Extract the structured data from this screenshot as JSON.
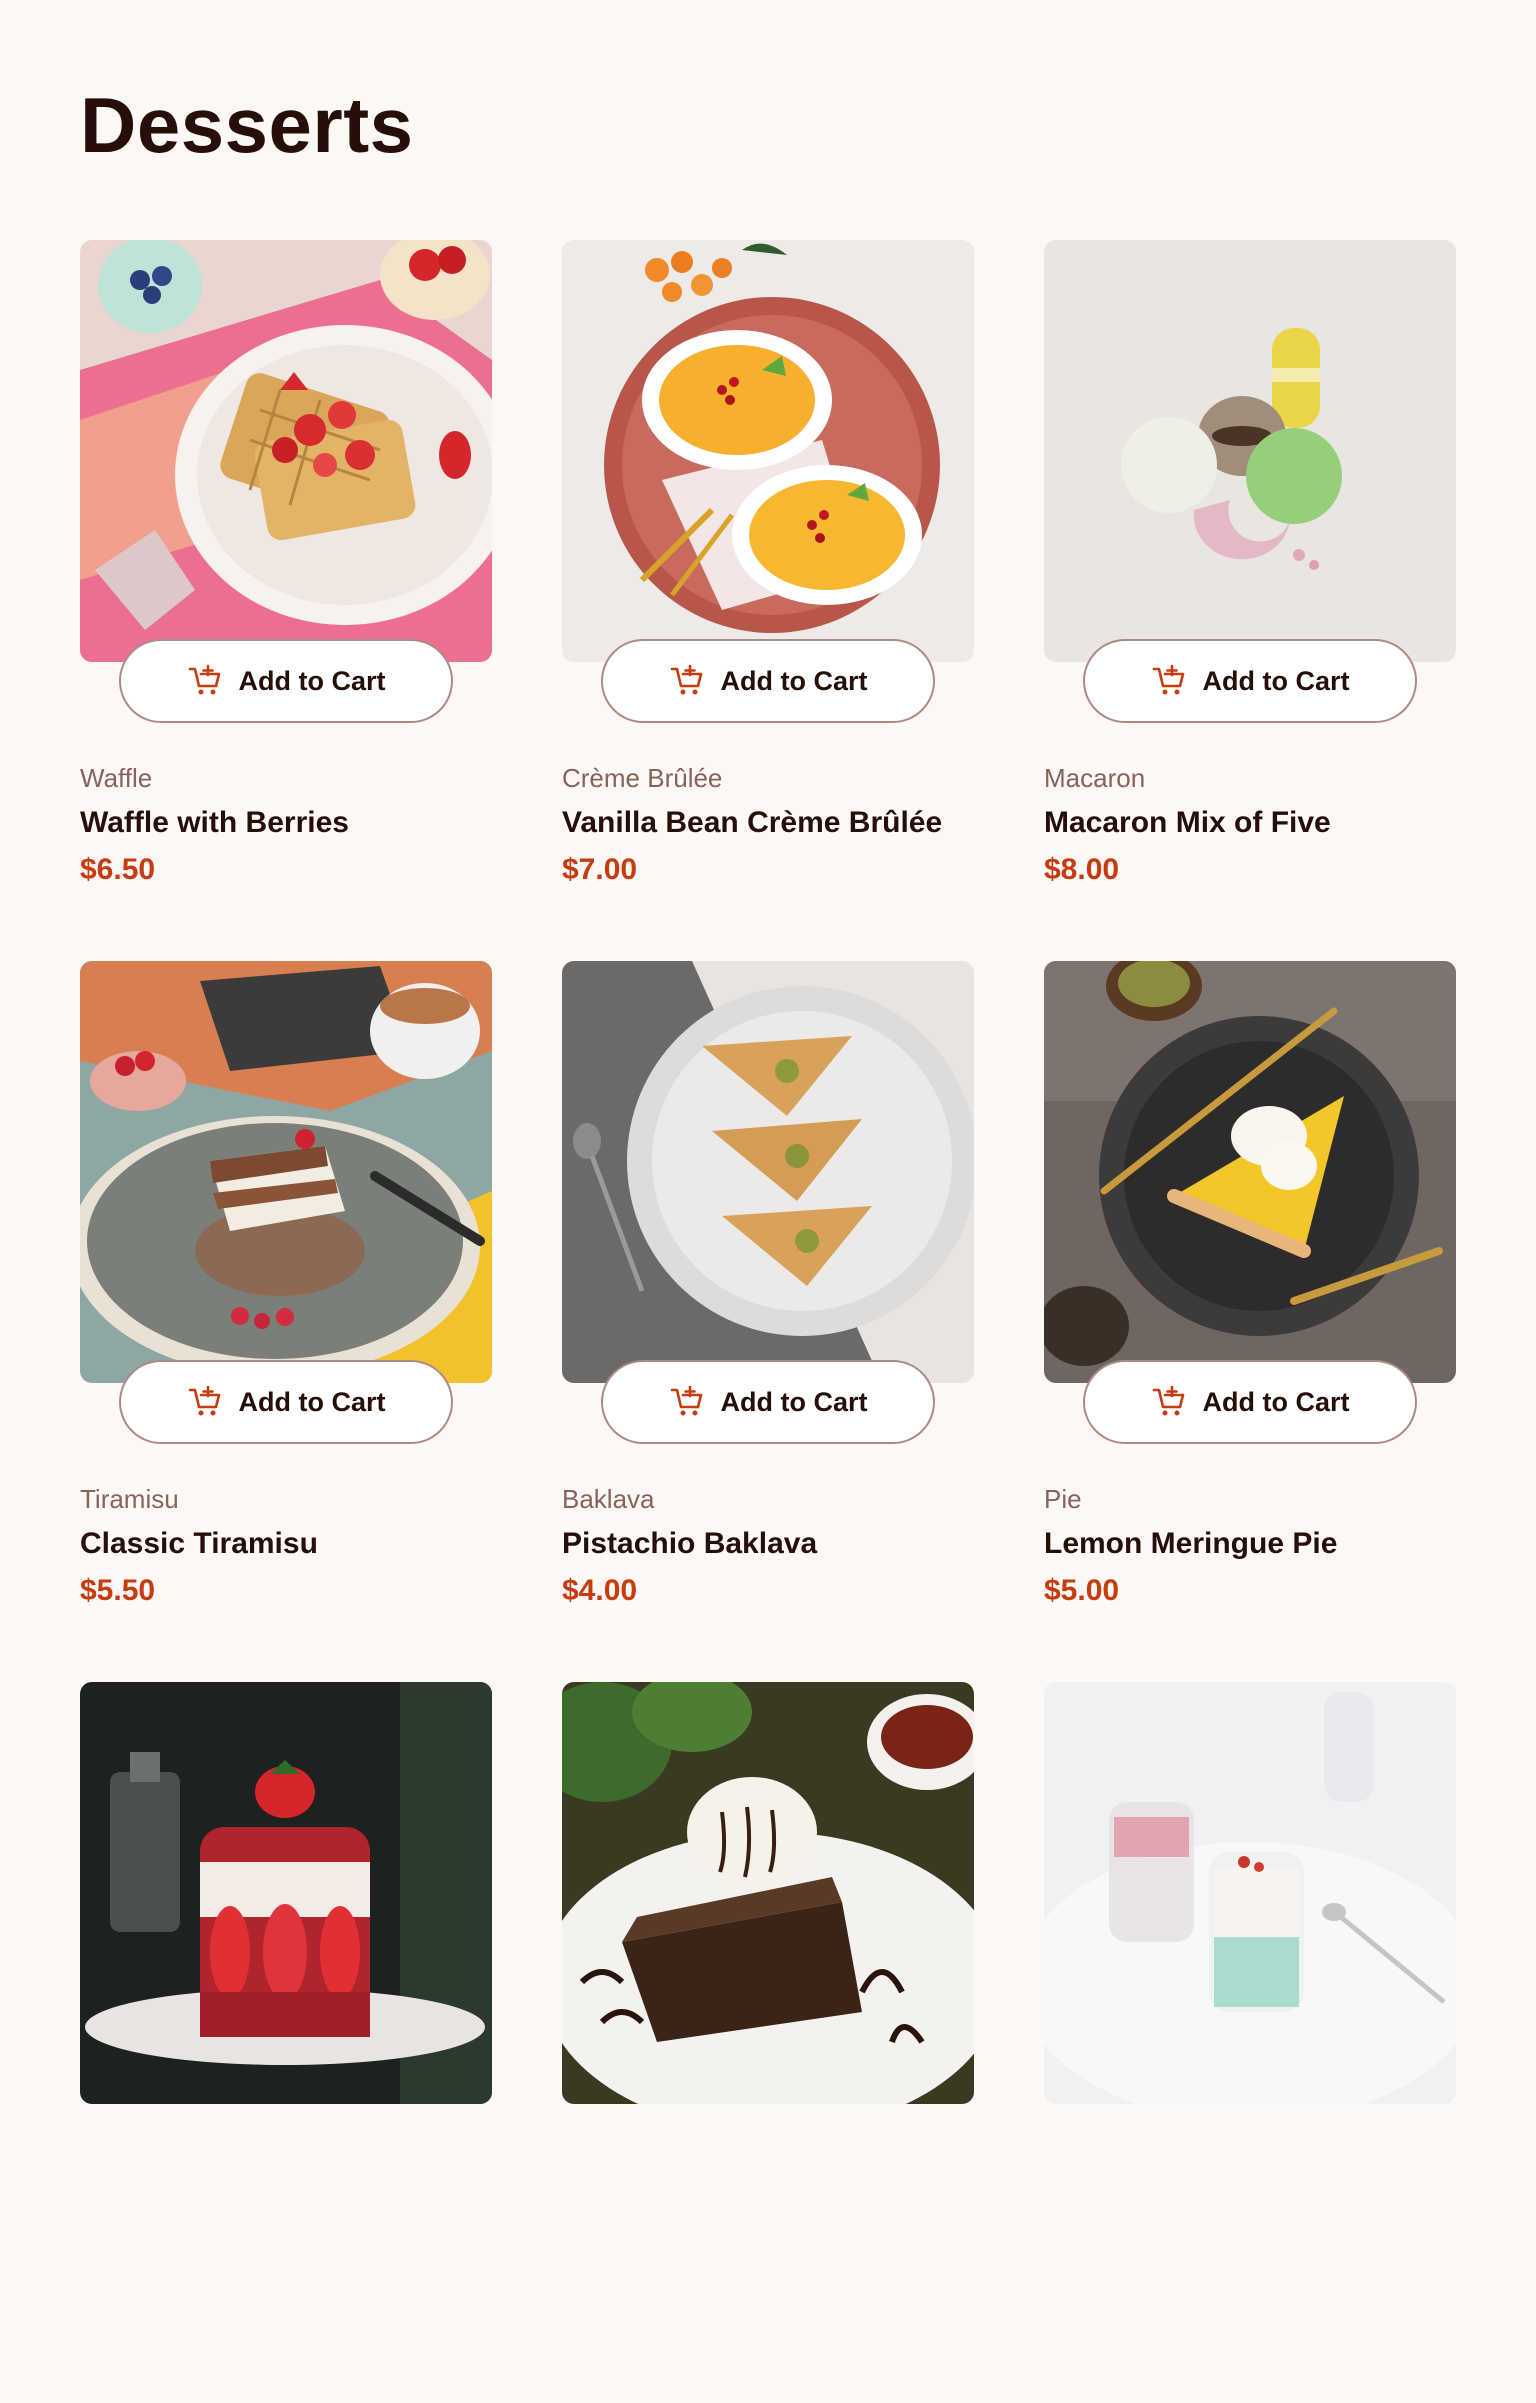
{
  "page": {
    "title": "Desserts"
  },
  "colors": {
    "background": "#fcf8f6",
    "accent_red": "#c73b0f",
    "text_dark": "#260f08",
    "text_muted": "#87635a",
    "button_border": "#ad8a85"
  },
  "products": [
    {
      "category": "Waffle",
      "name": "Waffle with Berries",
      "price": "$6.50",
      "button_label": "Add to Cart",
      "image_icon": "waffle-image"
    },
    {
      "category": "Crème Brûlée",
      "name": "Vanilla Bean Crème Brûlée",
      "price": "$7.00",
      "button_label": "Add to Cart",
      "image_icon": "creme-brulee-image"
    },
    {
      "category": "Macaron",
      "name": "Macaron Mix of Five",
      "price": "$8.00",
      "button_label": "Add to Cart",
      "image_icon": "macaron-image"
    },
    {
      "category": "Tiramisu",
      "name": "Classic Tiramisu",
      "price": "$5.50",
      "button_label": "Add to Cart",
      "image_icon": "tiramisu-image"
    },
    {
      "category": "Baklava",
      "name": "Pistachio Baklava",
      "price": "$4.00",
      "button_label": "Add to Cart",
      "image_icon": "baklava-image"
    },
    {
      "category": "Pie",
      "name": "Lemon Meringue Pie",
      "price": "$5.00",
      "button_label": "Add to Cart",
      "image_icon": "pie-image"
    },
    {
      "image_icon": "red-velvet-cake-image"
    },
    {
      "image_icon": "brownie-image"
    },
    {
      "image_icon": "panna-cotta-image"
    }
  ]
}
